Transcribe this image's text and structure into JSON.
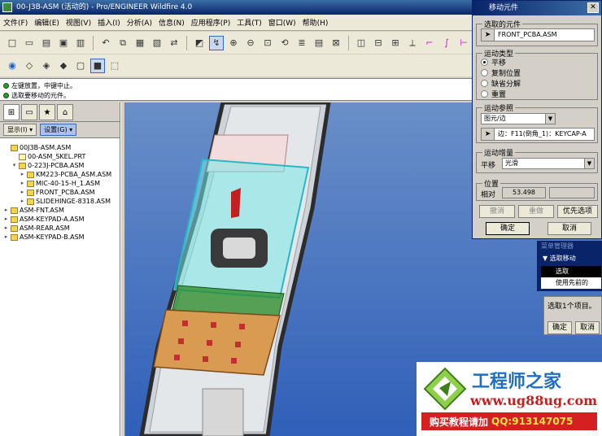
{
  "window": {
    "title": "00-J3B-ASM (活动的) - Pro/ENGINEER Wildfire 4.0"
  },
  "menu": [
    "文件(F)",
    "编辑(E)",
    "视图(V)",
    "插入(I)",
    "分析(A)",
    "信息(N)",
    "应用程序(P)",
    "工具(T)",
    "窗口(W)",
    "帮助(H)"
  ],
  "messages": [
    "左键放置，中键中止。",
    "选取要移动的元件。"
  ],
  "left_panel": {
    "show_button": "显示(I) ▾",
    "settings_button": "设置(G) ▾",
    "tree": [
      {
        "label": "00J3B-ASM.ASM",
        "level": 0,
        "expander": "",
        "type": "asm"
      },
      {
        "label": "00-ASM_SKEL.PRT",
        "level": 1,
        "expander": "",
        "type": "prt"
      },
      {
        "label": "0-223J-PCBA.ASM",
        "level": 1,
        "expander": "▾",
        "type": "asm"
      },
      {
        "label": "KM223-PCBA_ASM.ASM",
        "level": 2,
        "expander": "▸",
        "type": "asm"
      },
      {
        "label": "MIC-40-15-H_1.ASM",
        "level": 2,
        "expander": "▸",
        "type": "asm"
      },
      {
        "label": "FRONT_PCBA.ASM",
        "level": 2,
        "expander": "▸",
        "type": "asm"
      },
      {
        "label": "SLIDEHINGE-8318.ASM",
        "level": 2,
        "expander": "▸",
        "type": "asm"
      },
      {
        "label": "ASM-FNT.ASM",
        "level": 0,
        "expander": "▸",
        "type": "asm"
      },
      {
        "label": "ASM-KEYPAD-A.ASM",
        "level": 0,
        "expander": "▸",
        "type": "asm"
      },
      {
        "label": "ASM-REAR.ASM",
        "level": 0,
        "expander": "▸",
        "type": "asm"
      },
      {
        "label": "ASM-KEYPAD-B.ASM",
        "level": 0,
        "expander": "▸",
        "type": "asm"
      }
    ]
  },
  "dialog": {
    "title": "移动元件",
    "selected_group": "选取的元件",
    "selected_value": "FRONT_PCBA.ASM",
    "motion_type_group": "运动类型",
    "motion_types": [
      {
        "label": "平移",
        "checked": true
      },
      {
        "label": "复制位置",
        "checked": false
      },
      {
        "label": "缺省分解",
        "checked": false
      },
      {
        "label": "重置",
        "checked": false
      }
    ],
    "motion_ref_group": "运动参照",
    "motion_ref_combo": "图元/边",
    "motion_ref_value": "边：F11(倒角_1)：KEYCAP-A",
    "motion_inc_group": "运动增量",
    "translate_label": "平移",
    "translate_value": "光滑",
    "position_group": "位置",
    "relative_label": "相对",
    "relative_value": "53.498",
    "undo_button": "撤消",
    "redo_button": "重做",
    "preferences_button": "优先选项",
    "ok_button": "确定",
    "cancel_button": "取消"
  },
  "menu_manager": {
    "title": "菜单管理器",
    "header": "选取移动",
    "items": [
      "选取",
      "使用先前的"
    ]
  },
  "select_popup": {
    "text": "选取1个项目。",
    "ok": "确定",
    "cancel": "取消"
  },
  "banner": {
    "title": "工程师之家",
    "url": "www.ug88ug.com",
    "promo": "购买教程请加",
    "qq": "QQ:913147075"
  },
  "colors": {
    "title_bar": "#0a246a",
    "viewport_top": "#6a8fc8",
    "viewport_bottom": "#2f5fb8",
    "pcb_green": "#2f8f2f",
    "keypad_orange": "#d99a52"
  }
}
